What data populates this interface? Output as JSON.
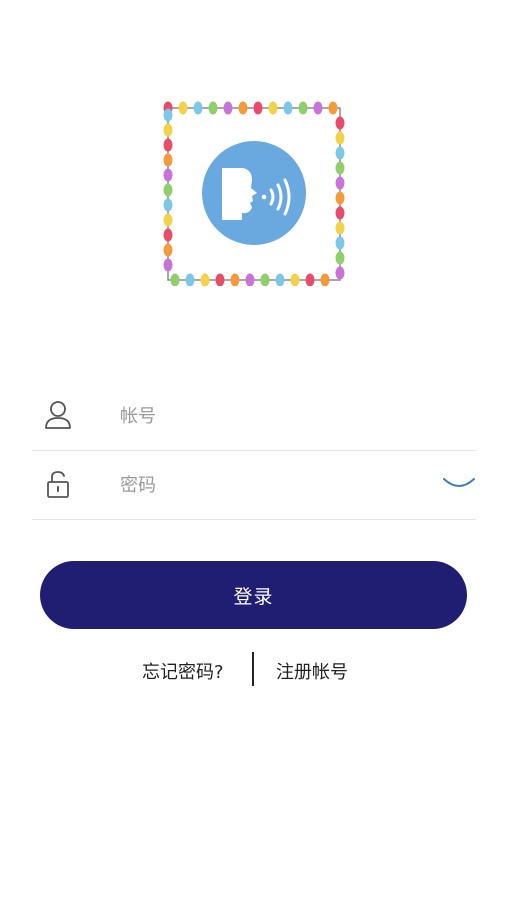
{
  "logo": {
    "accent": "#6aa9e0",
    "icon": "speaking-head-logo"
  },
  "form": {
    "account_placeholder": "帐号",
    "password_placeholder": "密码",
    "account_icon": "user-icon",
    "password_icon": "lock-icon",
    "toggle_icon": "eye-closed-icon"
  },
  "login_button": {
    "label": "登录",
    "color": "#201e72"
  },
  "links": {
    "forgot": "忘记密码?",
    "register": "注册帐号"
  }
}
